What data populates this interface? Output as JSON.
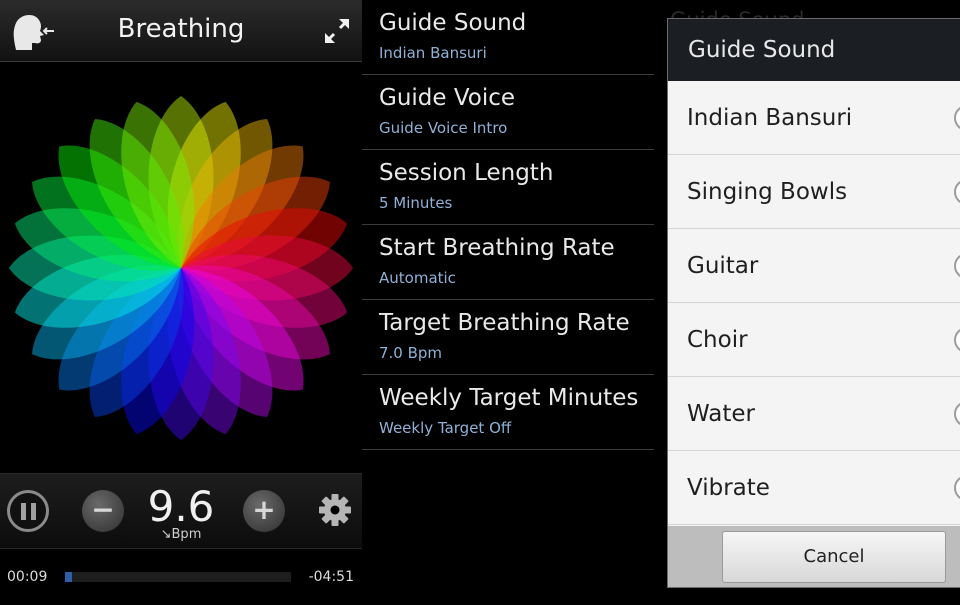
{
  "player": {
    "title": "Breathing",
    "rate_value": "9.6",
    "rate_unit": "↘Bpm",
    "elapsed": "00:09",
    "remaining": "-04:51",
    "progress_fraction": 0.03,
    "icons": [
      "head-breath-icon",
      "expand-icon",
      "pause-icon",
      "minus-icon",
      "plus-icon",
      "gear-icon"
    ]
  },
  "settings": {
    "items": [
      {
        "title": "Guide Sound",
        "value": "Indian Bansuri"
      },
      {
        "title": "Guide Voice",
        "value": "Guide Voice Intro"
      },
      {
        "title": "Session Length",
        "value": "5 Minutes"
      },
      {
        "title": "Start Breathing Rate",
        "value": "Automatic"
      },
      {
        "title": "Target Breathing Rate",
        "value": "7.0 Bpm"
      },
      {
        "title": "Weekly Target Minutes",
        "value": "Weekly Target Off"
      }
    ]
  },
  "dialog": {
    "background_title": "Guide Sound",
    "title": "Guide Sound",
    "options": [
      {
        "label": "Indian Bansuri"
      },
      {
        "label": "Singing Bowls"
      },
      {
        "label": "Guitar"
      },
      {
        "label": "Choir"
      },
      {
        "label": "Water"
      },
      {
        "label": "Vibrate"
      }
    ],
    "cancel_label": "Cancel"
  },
  "colors": {
    "accent_blue": "#8fb1d6",
    "progress_blue": "#2f5ea8",
    "dialog_header": "#1b1f24"
  }
}
